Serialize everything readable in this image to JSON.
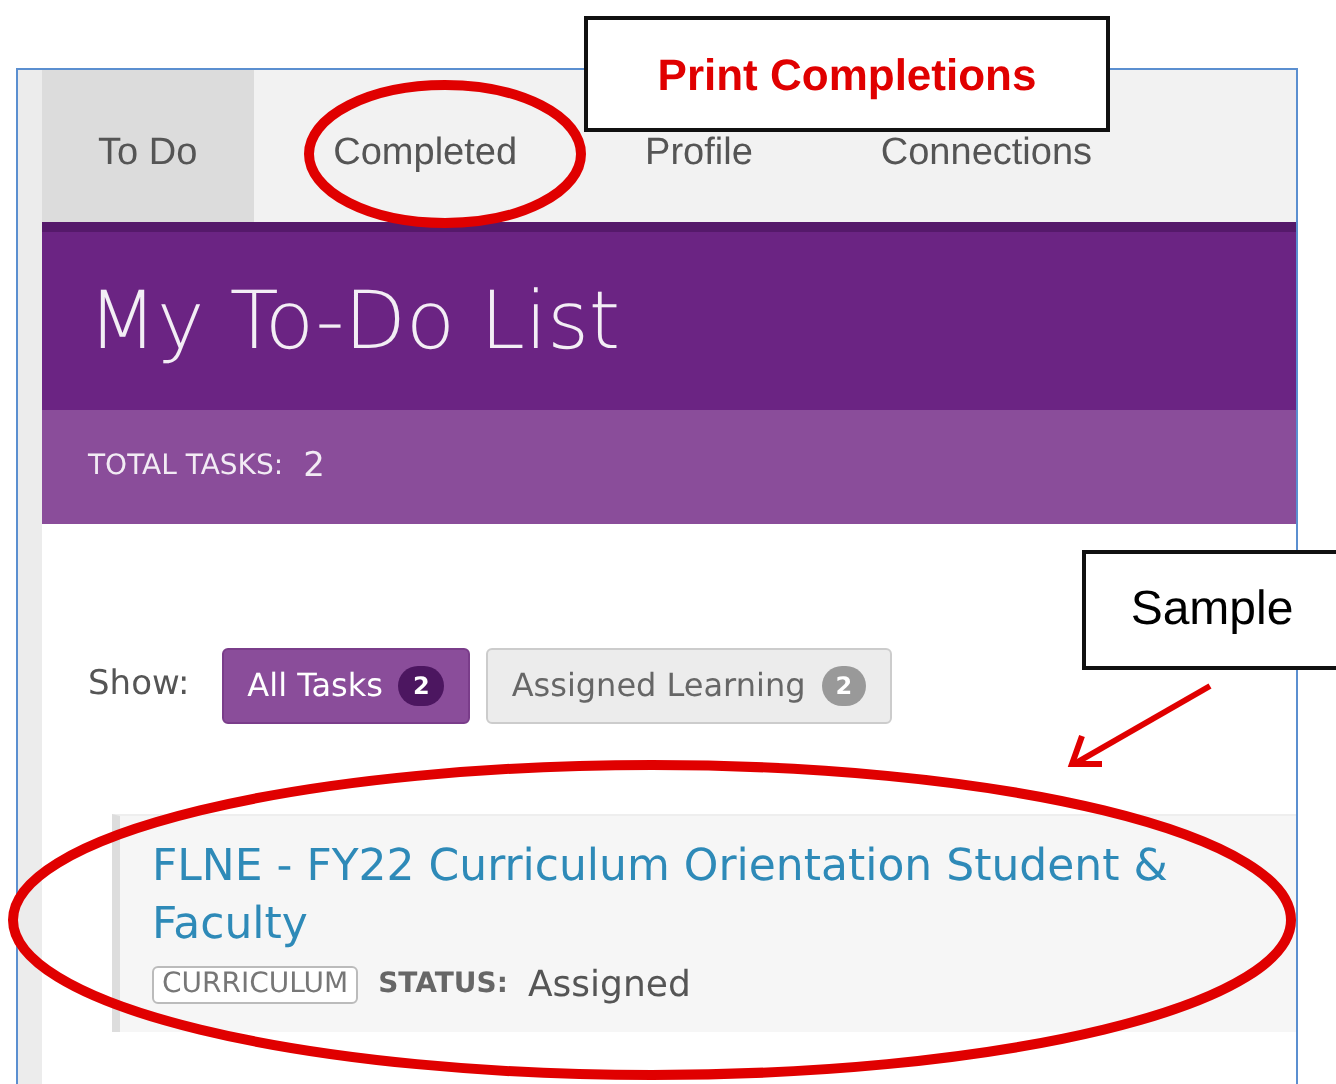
{
  "tabs": [
    {
      "label": "To Do",
      "selected": true
    },
    {
      "label": "Completed",
      "selected": false
    },
    {
      "label": "Profile",
      "selected": false
    },
    {
      "label": "Connections",
      "selected": false
    }
  ],
  "header": {
    "title": "My To-Do List",
    "total_label": "TOTAL TASKS:",
    "total_value": "2"
  },
  "filters": {
    "label": "Show:",
    "options": [
      {
        "label": "All Tasks",
        "count": "2",
        "selected": true
      },
      {
        "label": "Assigned Learning",
        "count": "2",
        "selected": false
      }
    ]
  },
  "tasks": [
    {
      "title": "FLNE - FY22 Curriculum Orientation Student & Faculty",
      "type": "CURRICULUM",
      "status_label": "STATUS:",
      "status": "Assigned"
    }
  ],
  "annotations": [
    {
      "kind": "callout",
      "text": "Print Completions"
    },
    {
      "kind": "ellipse"
    },
    {
      "kind": "callout",
      "text": "Sample"
    },
    {
      "kind": "arrow"
    },
    {
      "kind": "ellipse"
    }
  ]
}
